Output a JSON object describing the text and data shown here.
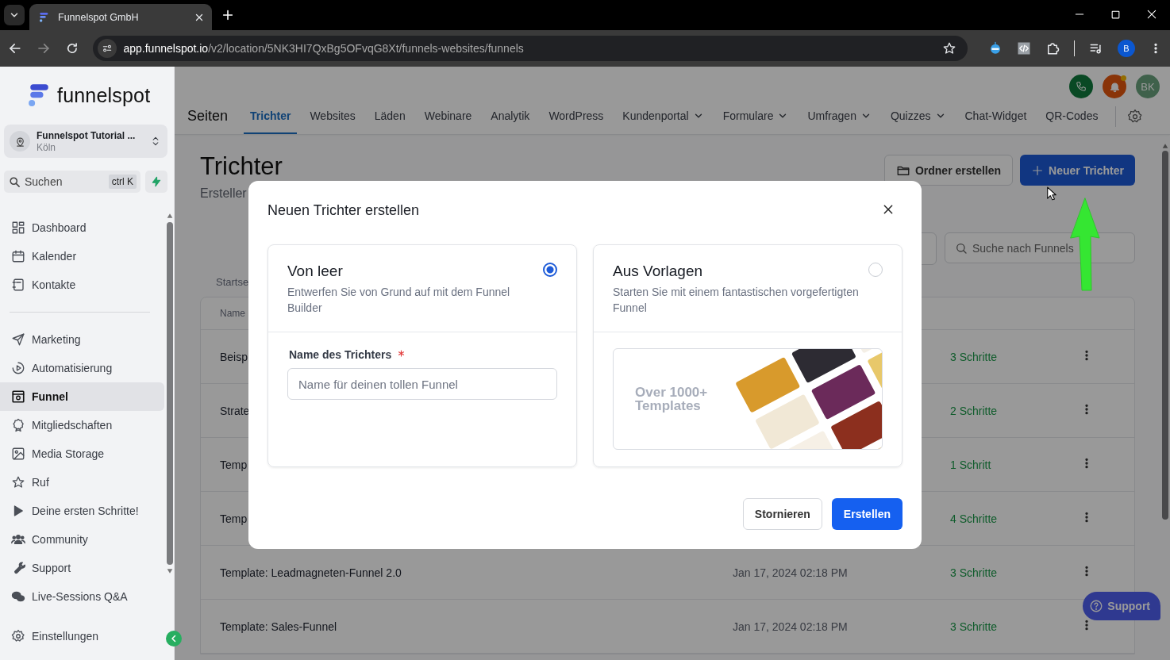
{
  "browser": {
    "tabs": [
      {
        "title": "Funnelspot GmbH",
        "selected": true
      }
    ],
    "url_host": "app.funnelspot.io",
    "url_path": "/v2/location/5NK3HI7QxBg5OFvqG8Xt/funnels-websites/funnels",
    "profile_initial": "B"
  },
  "sidebar": {
    "logo_text": "funnelspot",
    "account": {
      "name": "Funnelspot Tutorial ...",
      "location": "Köln"
    },
    "search": {
      "placeholder": "Suchen",
      "shortcut": "ctrl K"
    },
    "sections": [
      {
        "items": [
          {
            "label": "Dashboard",
            "selected": false
          },
          {
            "label": "Kalender",
            "selected": false
          },
          {
            "label": "Kontakte",
            "selected": false
          }
        ]
      },
      {
        "items": [
          {
            "label": "Marketing",
            "selected": false
          },
          {
            "label": "Automatisierung",
            "selected": false
          },
          {
            "label": "Funnel",
            "selected": true
          },
          {
            "label": "Mitgliedschaften",
            "selected": false
          },
          {
            "label": "Media Storage",
            "selected": false
          },
          {
            "label": "Ruf",
            "selected": false
          },
          {
            "label": "Deine ersten Schritte!",
            "selected": false
          },
          {
            "label": "Community",
            "selected": false
          },
          {
            "label": "Support",
            "selected": false
          },
          {
            "label": "Live-Sessions Q&A",
            "selected": false
          }
        ]
      }
    ],
    "footer_item": {
      "label": "Einstellungen"
    }
  },
  "header": {
    "avatar_initials": "BK"
  },
  "nav": {
    "title": "Seiten",
    "tabs": [
      {
        "label": "Trichter",
        "selected": true,
        "has_menu": false
      },
      {
        "label": "Websites",
        "selected": false,
        "has_menu": false
      },
      {
        "label": "Läden",
        "selected": false,
        "has_menu": false
      },
      {
        "label": "Webinare",
        "selected": false,
        "has_menu": false
      },
      {
        "label": "Analytik",
        "selected": false,
        "has_menu": false
      },
      {
        "label": "WordPress",
        "selected": false,
        "has_menu": false
      },
      {
        "label": "Kundenportal",
        "selected": false,
        "has_menu": true
      },
      {
        "label": "Formulare",
        "selected": false,
        "has_menu": true
      },
      {
        "label": "Umfragen",
        "selected": false,
        "has_menu": true
      },
      {
        "label": "Quizzes",
        "selected": false,
        "has_menu": true
      },
      {
        "label": "Chat-Widget",
        "selected": false,
        "has_menu": false
      },
      {
        "label": "QR-Codes",
        "selected": false,
        "has_menu": false
      }
    ]
  },
  "page": {
    "title": "Trichter",
    "subtitle": "Ersteller",
    "folder_button": "Ordner erstellen",
    "new_button": "Neuer Trichter",
    "search": {
      "placeholder": "Suche nach Funnels"
    },
    "section_label": "Startse",
    "table": {
      "columns": [
        "Name"
      ],
      "rows": [
        {
          "name": "Beisp",
          "steps": "3 Schritte"
        },
        {
          "name": "Strate",
          "steps": "2 Schritte"
        },
        {
          "name": "Temp",
          "steps": "1 Schritt"
        },
        {
          "name": "Temp",
          "steps": "4 Schritte"
        },
        {
          "name": "Template: Leadmagneten-Funnel 2.0",
          "date": "Jan 17, 2024 02:18 PM",
          "steps": "3 Schritte"
        },
        {
          "name": "Template: Sales-Funnel",
          "date": "Jan 17, 2024 02:18 PM",
          "steps": "3 Schritte"
        }
      ]
    }
  },
  "support_button": "Support",
  "modal": {
    "title": "Neuen Trichter erstellen",
    "options": [
      {
        "kind": "blank",
        "title": "Von leer",
        "description": "Entwerfen Sie von Grund auf mit dem Funnel Builder",
        "selected": true,
        "field": {
          "label": "Name des Trichters",
          "required": true,
          "placeholder": "Name für deinen tollen Funnel"
        }
      },
      {
        "kind": "templates",
        "title": "Aus Vorlagen",
        "description": "Starten Sie mit einem fantastischen vorgefertigten Funnel",
        "selected": false,
        "preview_text": "Over 1000+ Templates"
      }
    ],
    "cancel_button": "Stornieren",
    "confirm_button": "Erstellen"
  }
}
